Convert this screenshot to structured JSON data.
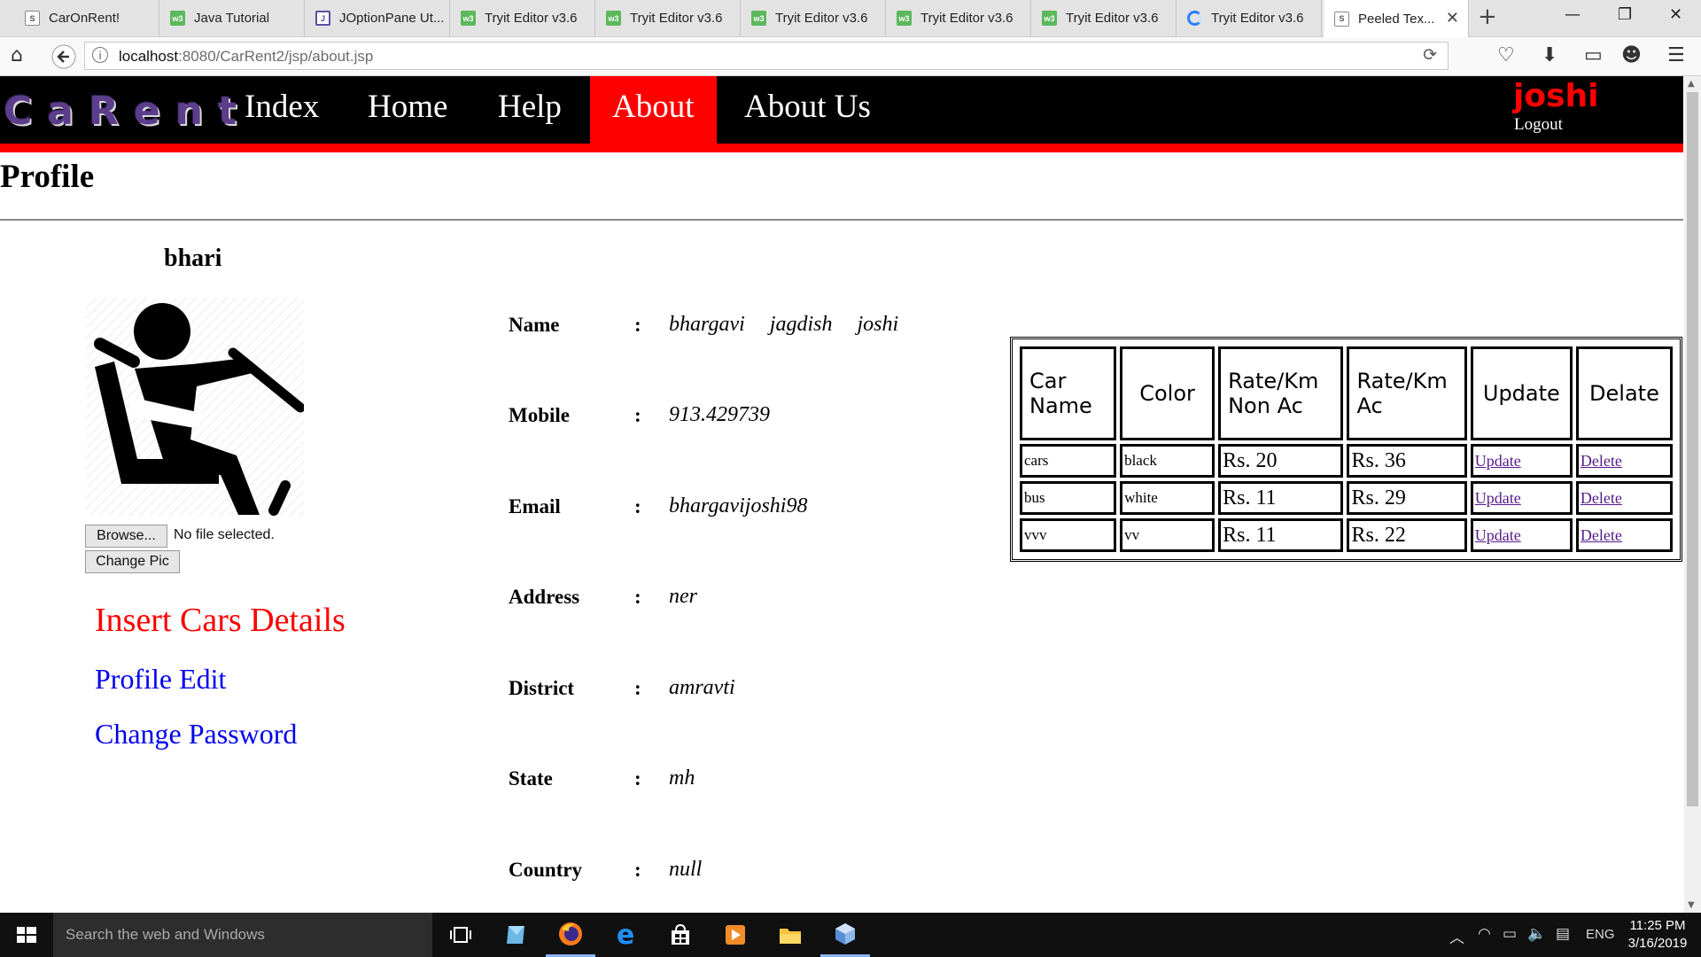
{
  "browser": {
    "tabs": [
      {
        "title": "CarOnRent!",
        "favicon": "page-icon"
      },
      {
        "title": "Java Tutorial",
        "favicon": "w3schools-icon"
      },
      {
        "title": "JOptionPane Ut...",
        "favicon": "doc-icon"
      },
      {
        "title": "Tryit Editor v3.6",
        "favicon": "w3schools-icon"
      },
      {
        "title": "Tryit Editor v3.6",
        "favicon": "w3schools-icon"
      },
      {
        "title": "Tryit Editor v3.6",
        "favicon": "w3schools-icon"
      },
      {
        "title": "Tryit Editor v3.6",
        "favicon": "w3schools-icon"
      },
      {
        "title": "Tryit Editor v3.6",
        "favicon": "w3schools-icon"
      },
      {
        "title": "Tryit Editor v3.6",
        "favicon": "loading-icon"
      },
      {
        "title": "Peeled Tex...",
        "favicon": "page-icon"
      }
    ],
    "url_host": "localhost",
    "url_path": ":8080/CarRent2/jsp/about.jsp"
  },
  "site": {
    "logo": "CaRent",
    "nav": [
      "Index",
      "Home",
      "Help",
      "About",
      "About Us"
    ],
    "active_nav": "About",
    "user": "joshi",
    "logout": "Logout",
    "accent_color": "#ff0000"
  },
  "profile": {
    "title": "Profile",
    "username": "bhari",
    "browse_label": "Browse...",
    "file_status": "No file selected.",
    "change_pic_label": "Change Pic",
    "links": {
      "insert": "Insert Cars Details",
      "edit": "Profile Edit",
      "password": "Change Password"
    },
    "fields": [
      {
        "label": "Name",
        "value": "bhargavi jagdish joshi"
      },
      {
        "label": "Mobile",
        "value": "913.429739"
      },
      {
        "label": "Email",
        "value": "bhargavijoshi98"
      },
      {
        "label": "Address",
        "value": "ner"
      },
      {
        "label": "District",
        "value": "amravti"
      },
      {
        "label": "State",
        "value": "mh"
      },
      {
        "label": "Country",
        "value": "null"
      }
    ]
  },
  "cars": {
    "headers": [
      "Car Name",
      "Color",
      "Rate/Km Non Ac",
      "Rate/Km Ac",
      "Update",
      "Delate"
    ],
    "rows": [
      {
        "name": "cars",
        "color": "black",
        "non_ac": "Rs. 20",
        "ac": "Rs. 36",
        "update": "Update",
        "delete": "Delete"
      },
      {
        "name": "bus",
        "color": "white",
        "non_ac": "Rs. 11",
        "ac": "Rs. 29",
        "update": "Update",
        "delete": "Delete"
      },
      {
        "name": "vvv",
        "color": "vv",
        "non_ac": "Rs. 11",
        "ac": "Rs. 22",
        "update": "Update",
        "delete": "Delete"
      }
    ]
  },
  "taskbar": {
    "search_placeholder": "Search the web and Windows",
    "language": "ENG",
    "time": "11:25 PM",
    "date": "3/16/2019"
  }
}
